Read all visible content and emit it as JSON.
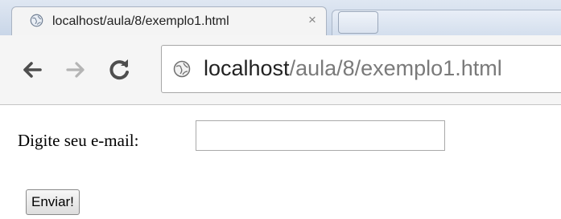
{
  "browser": {
    "tab": {
      "title": "localhost/aula/8/exemplo1.html",
      "icon": "globe-icon"
    },
    "nav": {
      "back_icon": "back-arrow-icon",
      "forward_icon": "forward-arrow-icon",
      "reload_icon": "reload-icon"
    },
    "omnibox": {
      "icon": "globe-icon",
      "host": "localhost",
      "path": "/aula/8/exemplo1.html"
    }
  },
  "page": {
    "form": {
      "email_label": "Digite seu e-mail:",
      "email_value": "",
      "submit_label": "Enviar!"
    }
  }
}
